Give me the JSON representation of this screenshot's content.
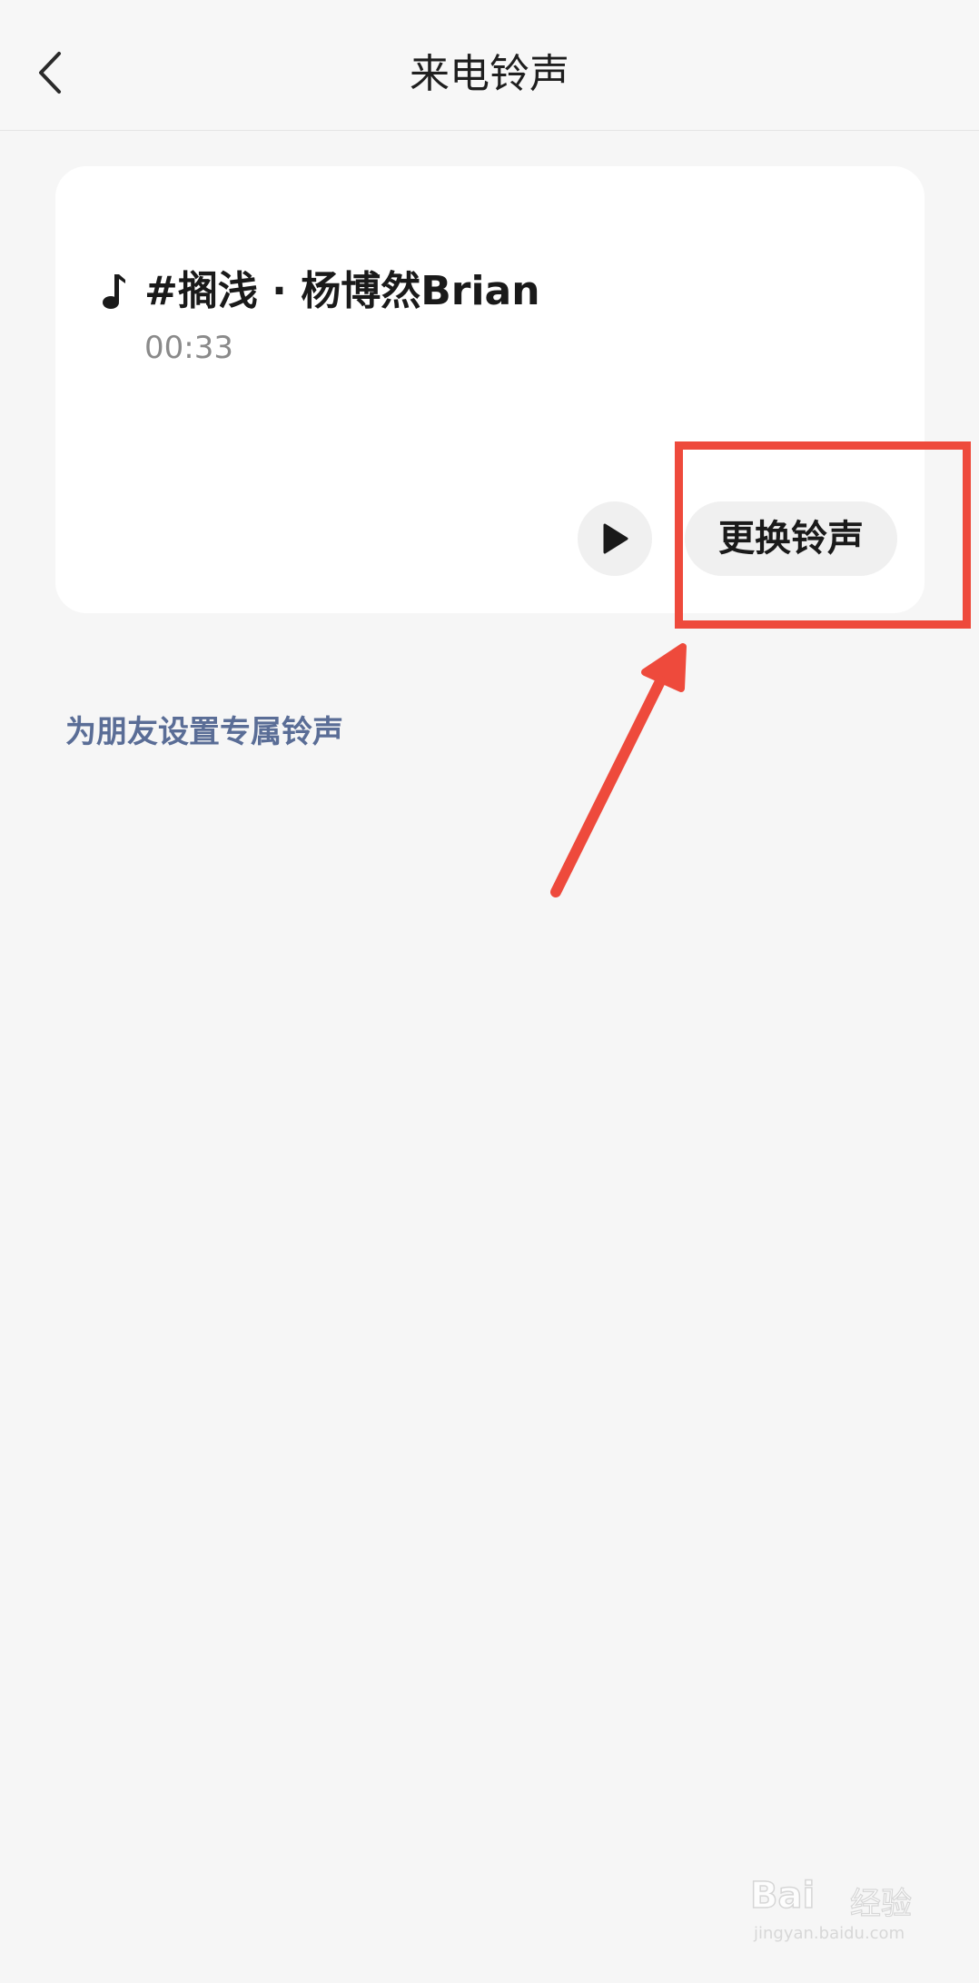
{
  "header": {
    "title": "来电铃声"
  },
  "ringtone": {
    "title": "#搁浅 · 杨博然Brian",
    "duration": "00:33",
    "change_label": "更换铃声"
  },
  "friend_link": "为朋友设置专属铃声",
  "watermark": {
    "brand": "Bai",
    "text": "经验",
    "url": "jingyan.baidu.com"
  },
  "colors": {
    "annotation": "#ee4a3c",
    "link": "#5a6d96",
    "background": "#f6f6f6",
    "card": "#ffffff"
  },
  "icons": [
    "chevron-left-icon",
    "music-note-icon",
    "play-icon"
  ]
}
